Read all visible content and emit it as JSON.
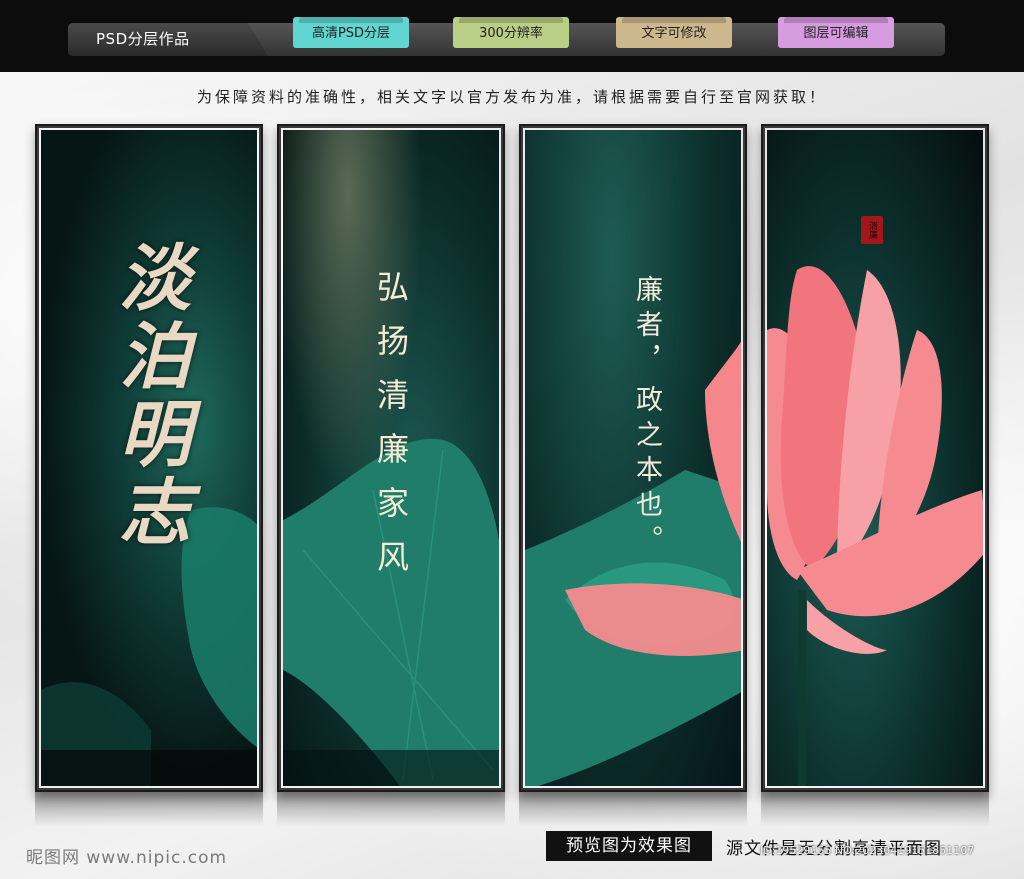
{
  "header": {
    "brand": "PSD分层作品",
    "tags": [
      "高清PSD分层",
      "300分辨率",
      "文字可修改",
      "图层可编辑"
    ]
  },
  "notice": "为保障资料的准确性，相关文字以官方发布为准，请根据需要自行至官网获取！",
  "panels": {
    "panel1": {
      "calligraphy": "淡泊明志"
    },
    "panel2": {
      "slogan": "弘扬清廉家风"
    },
    "panel3": {
      "line1": "廉者，",
      "line2": "政之本也。"
    },
    "panel4": {
      "seal": "清廉"
    }
  },
  "footer": {
    "watermark": "昵图网 www.nipic.com",
    "preview_label": "预览图为效果图",
    "source_label": "源文件是无分割高清平面图",
    "image_id": "ID:19529155 NO:20230419151851107"
  },
  "colors": {
    "tag1": "#61d6d0",
    "tag2": "#b9cf86",
    "tag3": "#cdb88e",
    "tag4": "#d79be0",
    "lotus": "#f07c84",
    "leaf": "#1f7a66"
  }
}
